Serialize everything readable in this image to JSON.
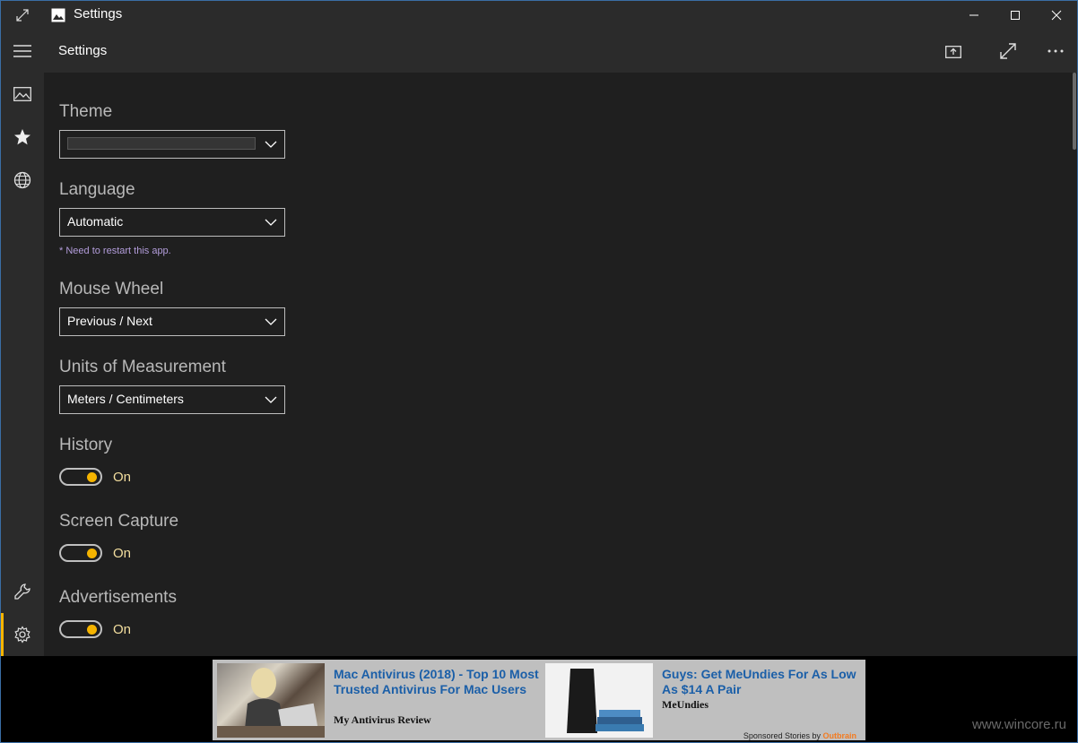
{
  "window": {
    "title": "Settings",
    "controls": {
      "minimize_icon": "minimize-icon",
      "maximize_icon": "maximize-icon",
      "close_icon": "close-icon"
    }
  },
  "rail": {
    "items": [
      {
        "icon": "hamburger-menu-icon"
      },
      {
        "icon": "picture-icon"
      },
      {
        "icon": "star-icon"
      },
      {
        "icon": "globe-icon"
      },
      {
        "icon": "wrench-icon"
      },
      {
        "icon": "gear-icon",
        "selected": true
      }
    ]
  },
  "header": {
    "title": "Settings",
    "actions": [
      "share-icon",
      "fullscreen-icon",
      "more-icon"
    ]
  },
  "settings": {
    "theme": {
      "label": "Theme",
      "value": ""
    },
    "language": {
      "label": "Language",
      "value": "Automatic",
      "note": "* Need to restart this app."
    },
    "mouse_wheel": {
      "label": "Mouse Wheel",
      "value": "Previous / Next"
    },
    "units": {
      "label": "Units of Measurement",
      "value": "Meters / Centimeters"
    },
    "history": {
      "label": "History",
      "state": "On"
    },
    "screen_capture": {
      "label": "Screen Capture",
      "state": "On"
    },
    "advertisements": {
      "label": "Advertisements",
      "state": "On"
    }
  },
  "ads": {
    "items": [
      {
        "title": "Mac Antivirus (2018) - Top 10 Most Trusted Antivirus For Mac Users",
        "source": "My Antivirus Review"
      },
      {
        "title": "Guys: Get MeUndies For As Low As $14 A Pair",
        "source": "MeUndies"
      }
    ],
    "sponsor_prefix": "Sponsored Stories by",
    "sponsor_brand": "Outbrain"
  },
  "watermark": "www.wincore.ru",
  "colors": {
    "accent": "#f5b400",
    "chrome": "#2b2b2b",
    "content_bg": "#1f1f1f",
    "ad_link": "#1b5fa8"
  }
}
